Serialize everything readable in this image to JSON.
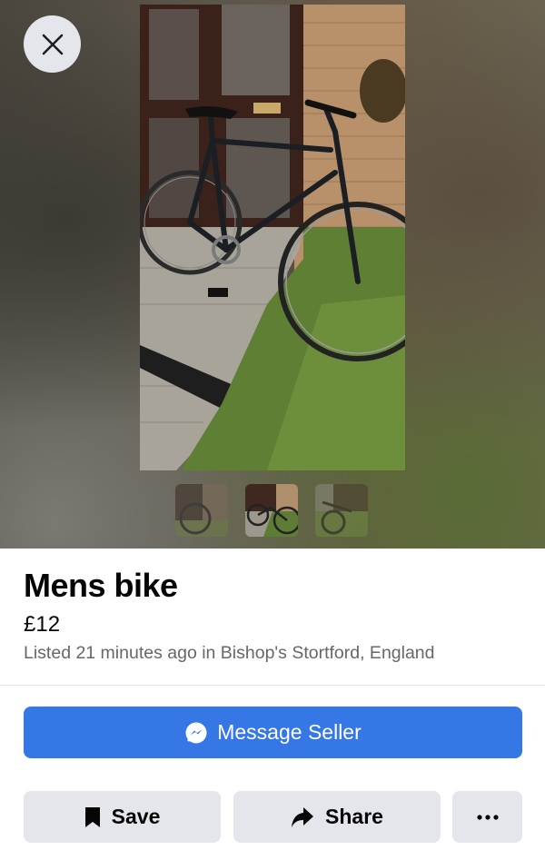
{
  "photo": {
    "close_icon": "close-icon",
    "thumbnails": [
      "thumbnail-1",
      "thumbnail-2",
      "thumbnail-3"
    ],
    "selected_thumbnail": 2
  },
  "listing": {
    "title": "Mens bike",
    "price": "£12",
    "meta": "Listed 21 minutes ago in Bishop's Stortford, England"
  },
  "actions": {
    "message_label": "Message Seller",
    "message_icon": "messenger-icon",
    "save_label": "Save",
    "save_icon": "bookmark-icon",
    "share_label": "Share",
    "share_icon": "share-arrow-icon",
    "more_icon": "more-dots-icon"
  },
  "colors": {
    "primary_button": "#3578e5",
    "secondary_button": "#e4e6eb",
    "meta_text": "#65676b"
  }
}
